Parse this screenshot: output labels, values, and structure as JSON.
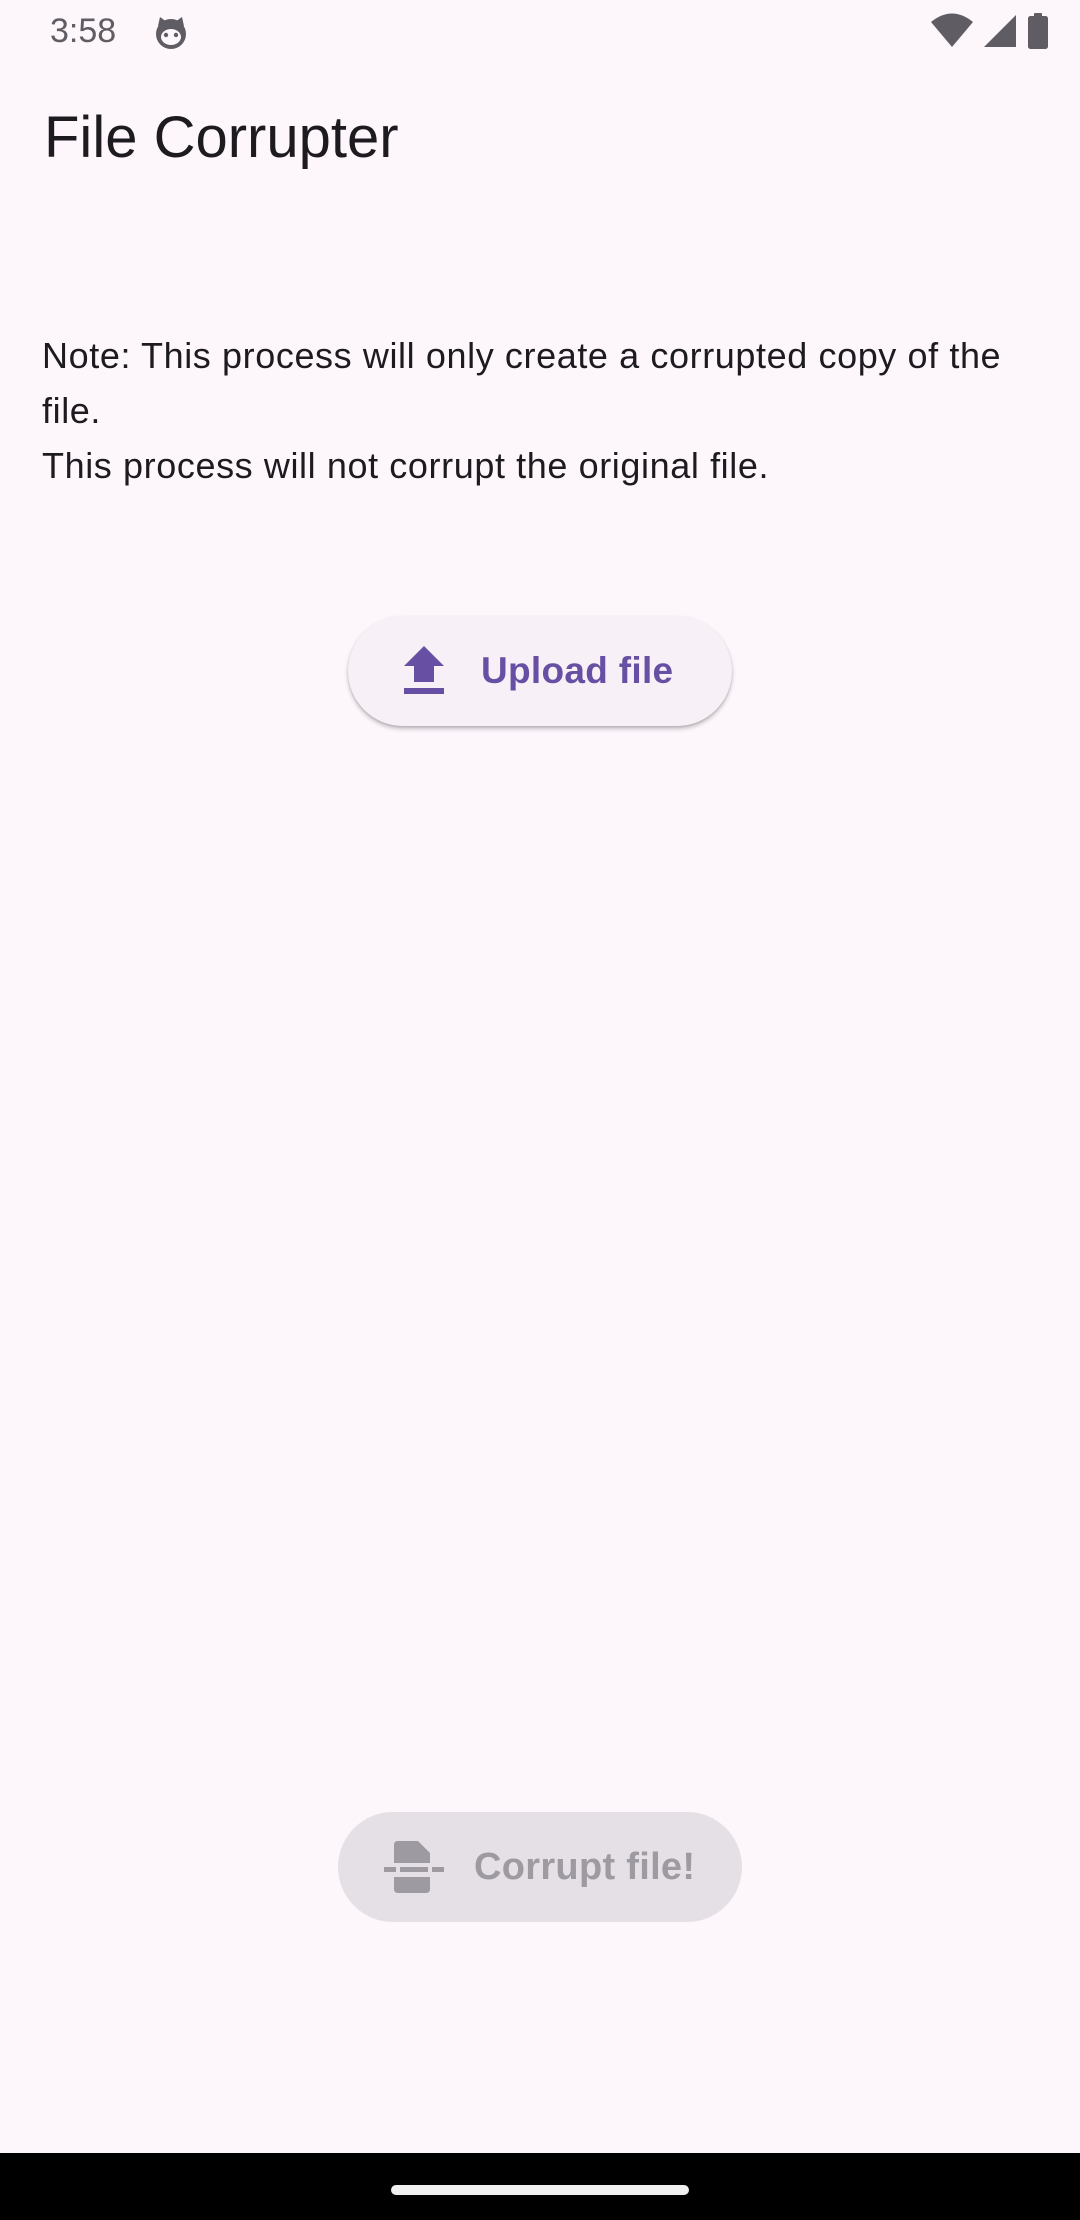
{
  "status_bar": {
    "time": "3:58",
    "icons": [
      "cat-face-icon",
      "wifi-icon",
      "cellular-signal-icon",
      "battery-icon"
    ]
  },
  "app_bar": {
    "title": "File Corrupter"
  },
  "note": {
    "line1": "Note: This process will only create a corrupted copy of the file.",
    "line2": "This process will not corrupt the original file."
  },
  "upload": {
    "label": "Upload file",
    "icon": "upload-icon"
  },
  "corrupt": {
    "label": "Corrupt file!",
    "icon": "file-cut-icon",
    "enabled": false
  },
  "colors": {
    "background": "#fdf7fc",
    "accent": "#6750a4",
    "disabled_text": "#9e9aa1",
    "disabled_container": "#e5dfe6"
  }
}
